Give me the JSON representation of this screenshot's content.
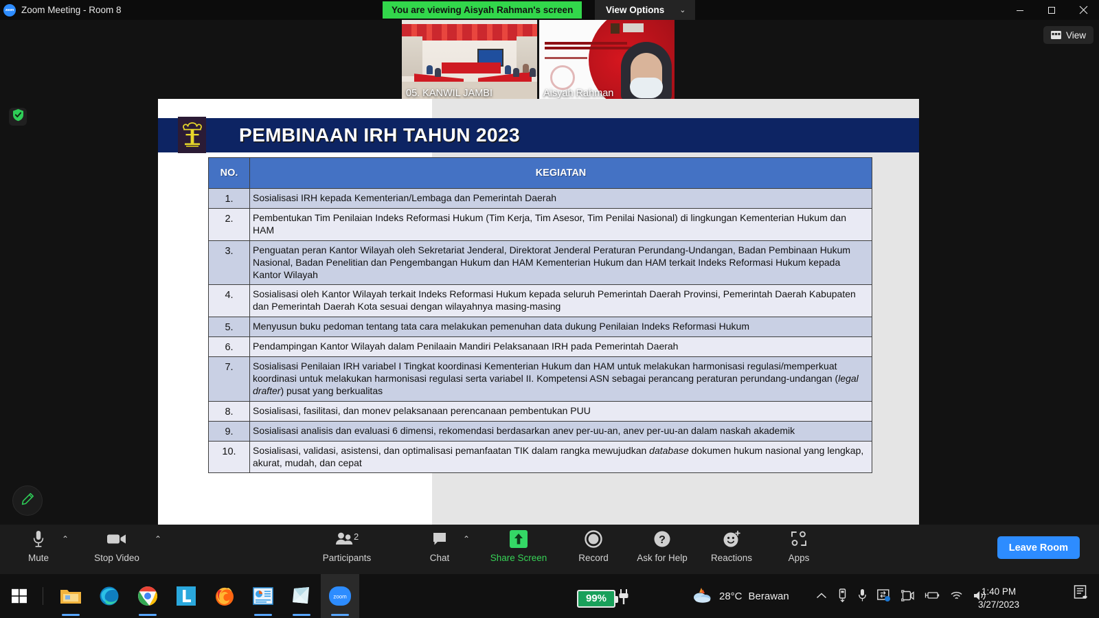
{
  "titlebar": {
    "app_title": "Zoom Meeting - Room 8",
    "logo_text": "zoom",
    "share_banner": "You are viewing Aisyah Rahman's screen",
    "view_options": "View Options",
    "caret": "⌄",
    "minimize": "─",
    "maximize": "❐",
    "close": "✕"
  },
  "thumbnails": [
    {
      "name": "05. KANWIL JAMBI"
    },
    {
      "name": "Aisyah Rahman"
    }
  ],
  "view_button": {
    "label": "View",
    "icon": "grid-layout-icon"
  },
  "left_controls": {
    "encryption_icon": "shield-check-icon",
    "annotate_icon": "pencil-icon"
  },
  "slide": {
    "title": "PEMBINAAN IRH TAHUN 2023",
    "logo": "ministry-of-law-emblem",
    "table": {
      "headers": [
        "NO.",
        "KEGIATAN"
      ],
      "rows": [
        {
          "no": "1.",
          "kegiatan": "Sosialisasi IRH kepada Kementerian/Lembaga dan Pemerintah Daerah"
        },
        {
          "no": "2.",
          "kegiatan": "Pembentukan Tim Penilaian Indeks Reformasi Hukum (Tim Kerja, Tim Asesor, Tim Penilai Nasional) di lingkungan Kementerian Hukum dan HAM"
        },
        {
          "no": "3.",
          "kegiatan": "Penguatan peran Kantor Wilayah oleh Sekretariat Jenderal, Direktorat Jenderal Peraturan Perundang-Undangan, Badan Pembinaan Hukum Nasional, Badan Penelitian dan Pengembangan Hukum dan HAM Kementerian Hukum dan HAM terkait Indeks Reformasi Hukum kepada Kantor Wilayah"
        },
        {
          "no": "4.",
          "kegiatan": "Sosialisasi oleh Kantor Wilayah terkait Indeks Reformasi Hukum kepada seluruh Pemerintah Daerah Provinsi, Pemerintah Daerah Kabupaten dan Pemerintah Daerah Kota sesuai dengan wilayahnya masing-masing"
        },
        {
          "no": "5.",
          "kegiatan": "Menyusun buku pedoman tentang tata cara melakukan pemenuhan data dukung Penilaian Indeks Reformasi Hukum"
        },
        {
          "no": "6.",
          "kegiatan": "Pendampingan Kantor Wilayah dalam Penilaain Mandiri Pelaksanaan IRH pada Pemerintah Daerah"
        },
        {
          "no": "7.",
          "kegiatan": "Sosialisasi Penilaian IRH variabel I Tingkat koordinasi Kementerian Hukum dan HAM untuk melakukan harmonisasi regulasi/memperkuat koordinasi untuk melakukan harmonisasi regulasi serta variabel II. Kompetensi ASN sebagai perancang peraturan perundang-undangan (legal drafter) pusat yang berkualitas",
          "italic": "legal drafter"
        },
        {
          "no": "8.",
          "kegiatan": "Sosialisasi, fasilitasi, dan monev pelaksanaan perencanaan pembentukan PUU"
        },
        {
          "no": "9.",
          "kegiatan": "Sosialisasi analisis dan evaluasi 6 dimensi, rekomendasi berdasarkan anev per-uu-an, anev per-uu-an dalam naskah akademik"
        },
        {
          "no": "10.",
          "kegiatan": "Sosialisasi, validasi, asistensi, dan optimalisasi pemanfaatan TIK dalam rangka mewujudkan database dokumen hukum nasional yang lengkap, akurat, mudah, dan cepat",
          "italic": "database"
        }
      ]
    }
  },
  "toolbar": {
    "mute": {
      "label": "Mute",
      "icon": "microphone-icon"
    },
    "video": {
      "label": "Stop Video",
      "icon": "video-camera-icon"
    },
    "participants": {
      "label": "Participants",
      "icon": "people-icon",
      "count": "2"
    },
    "chat": {
      "label": "Chat",
      "icon": "chat-bubble-icon"
    },
    "share": {
      "label": "Share Screen",
      "icon": "share-up-arrow-icon"
    },
    "record": {
      "label": "Record",
      "icon": "record-circle-icon"
    },
    "help": {
      "label": "Ask for Help",
      "icon": "question-mark-icon"
    },
    "reactions": {
      "label": "Reactions",
      "icon": "smiley-plus-icon"
    },
    "apps": {
      "label": "Apps",
      "icon": "apps-bracket-icon"
    },
    "leave": "Leave Room",
    "caret": "⌃"
  },
  "taskbar": {
    "start": "windows-start-icon",
    "apps": [
      {
        "name": "file-explorer-icon",
        "running": true
      },
      {
        "name": "microsoft-edge-icon",
        "running": false
      },
      {
        "name": "google-chrome-icon",
        "running": true
      },
      {
        "name": "lightshot-icon",
        "running": false
      },
      {
        "name": "mozilla-firefox-icon",
        "running": false
      },
      {
        "name": "powerpoint-icon",
        "running": true
      },
      {
        "name": "sticky-notes-icon",
        "running": true
      },
      {
        "name": "zoom-app-icon",
        "running": true,
        "active": true
      }
    ],
    "battery": "99%",
    "plug_icon": "power-plug-icon",
    "weather": {
      "temp": "28°C",
      "condition": "Berawan",
      "icon": "partly-cloudy-icon"
    },
    "tray_icons": [
      "chevron-up-icon",
      "usb-device-icon",
      "microphone-tray-icon",
      "onedrive-icon",
      "camera-tray-icon",
      "battery-tray-icon",
      "wifi-icon",
      "speaker-icon"
    ],
    "clock": {
      "time": "1:40 PM",
      "date": "3/27/2023"
    },
    "notification": "notification-center-icon"
  },
  "colors": {
    "zoom_blue": "#2d8cff",
    "share_green": "#32d74b",
    "slide_navy": "#0d2463",
    "table_header_blue": "#4472c4",
    "row_odd": "#c9d0e4",
    "row_even": "#e9eaf4",
    "battery_green": "#19a05a"
  }
}
